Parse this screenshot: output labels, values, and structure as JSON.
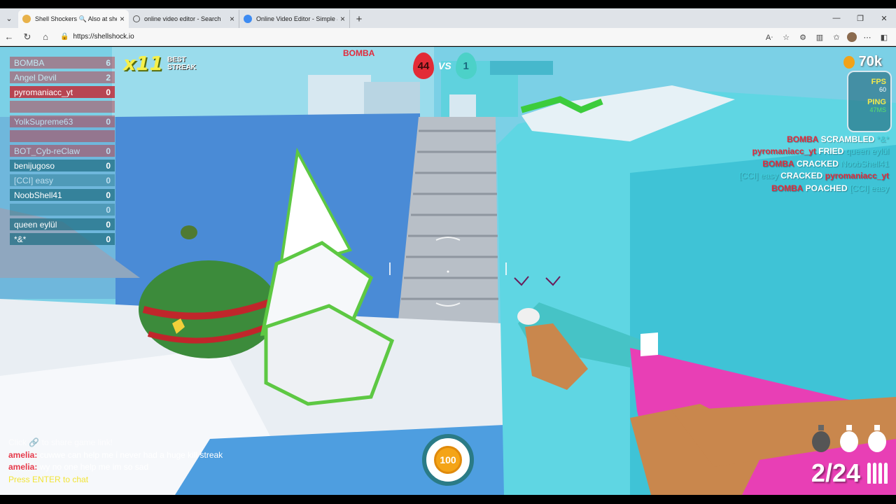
{
  "browser": {
    "tabs": [
      {
        "title": "Shell Shockers 🔍 Also at she",
        "active": true
      },
      {
        "title": "online video editor - Search",
        "active": false
      },
      {
        "title": "Online Video Editor - Simple & Fre",
        "active": false
      }
    ],
    "url": "https://shellshock.io",
    "icons": [
      "back-icon",
      "refresh-icon",
      "home-icon",
      "lock-icon",
      "read-aloud-icon",
      "favorite-icon",
      "extensions-icon",
      "split-screen-icon",
      "favorites-icon",
      "profile-icon",
      "more-icon",
      "copilot-icon"
    ]
  },
  "scoreboard": [
    {
      "name": "BOMBA",
      "score": "6",
      "team": "red",
      "faded": true
    },
    {
      "name": "Angel Devil",
      "score": "2",
      "team": "red",
      "faded": true
    },
    {
      "name": "pyromaniacc_yt",
      "score": "0",
      "team": "red",
      "faded": false
    },
    {
      "name": "",
      "score": "",
      "team": "red",
      "faded": true
    },
    {
      "name": "YolkSupreme63",
      "score": "0",
      "team": "red",
      "faded": true
    },
    {
      "name": "",
      "score": "",
      "team": "red",
      "faded": true
    },
    {
      "name": "BOT_Cyb-reClaw",
      "score": "0",
      "team": "red",
      "faded": true
    },
    {
      "name": "benijugoso",
      "score": "0",
      "team": "teal",
      "faded": false
    },
    {
      "name": "[CCI] easy",
      "score": "0",
      "team": "teal",
      "faded": true
    },
    {
      "name": "NoobShell41",
      "score": "0",
      "team": "teal",
      "faded": false
    },
    {
      "name": "",
      "score": "0",
      "team": "teal",
      "faded": true
    },
    {
      "name": "queen eylül",
      "score": "0",
      "team": "teal",
      "faded": false
    },
    {
      "name": "*&*",
      "score": "0",
      "team": "teal",
      "faded": false
    }
  ],
  "streak": {
    "value": "x11",
    "label_1": "BEST",
    "label_2": "STREAK"
  },
  "teams": {
    "red_score": "44",
    "vs_label": "VS",
    "blue_score": "1",
    "enemy_tag": "BOMBA"
  },
  "hud": {
    "coins": "70k",
    "fps_label": "FPS",
    "fps_value": "60",
    "ping_label": "PING",
    "ping_value": "47MS",
    "health": "100",
    "ammo": "2/24"
  },
  "killfeed": [
    {
      "killer": "BOMBA",
      "killer_team": "red",
      "action": "SCRAMBLED",
      "victim": "*&*",
      "victim_team": "blue"
    },
    {
      "killer": "pyromaniacc_yt",
      "killer_team": "red",
      "action": "FRIED",
      "victim": "queen eylül",
      "victim_team": "blue"
    },
    {
      "killer": "BOMBA",
      "killer_team": "red",
      "action": "CRACKED",
      "victim": "NoobShell41",
      "victim_team": "blue"
    },
    {
      "killer": "[CCI] easy",
      "killer_team": "blue",
      "action": "CRACKED",
      "victim": "pyromaniacc_yt",
      "victim_team": "red"
    },
    {
      "killer": "BOMBA",
      "killer_team": "red",
      "action": "POACHED",
      "victim": "[CCI] easy",
      "victim_team": "blue"
    }
  ],
  "chat": {
    "system": "Click 🔗 to share game link!",
    "messages": [
      {
        "name": "amelia:",
        "text": "cuwwe can help me i never had a huge kill streak"
      },
      {
        "name": "amelia:",
        "text": "wy no one help me im so sad"
      }
    ],
    "hint": "Press ENTER to chat"
  },
  "colors": {
    "red_team": "#e22a3b",
    "blue_team": "#3fd0de",
    "accent": "#f3ea4b"
  }
}
